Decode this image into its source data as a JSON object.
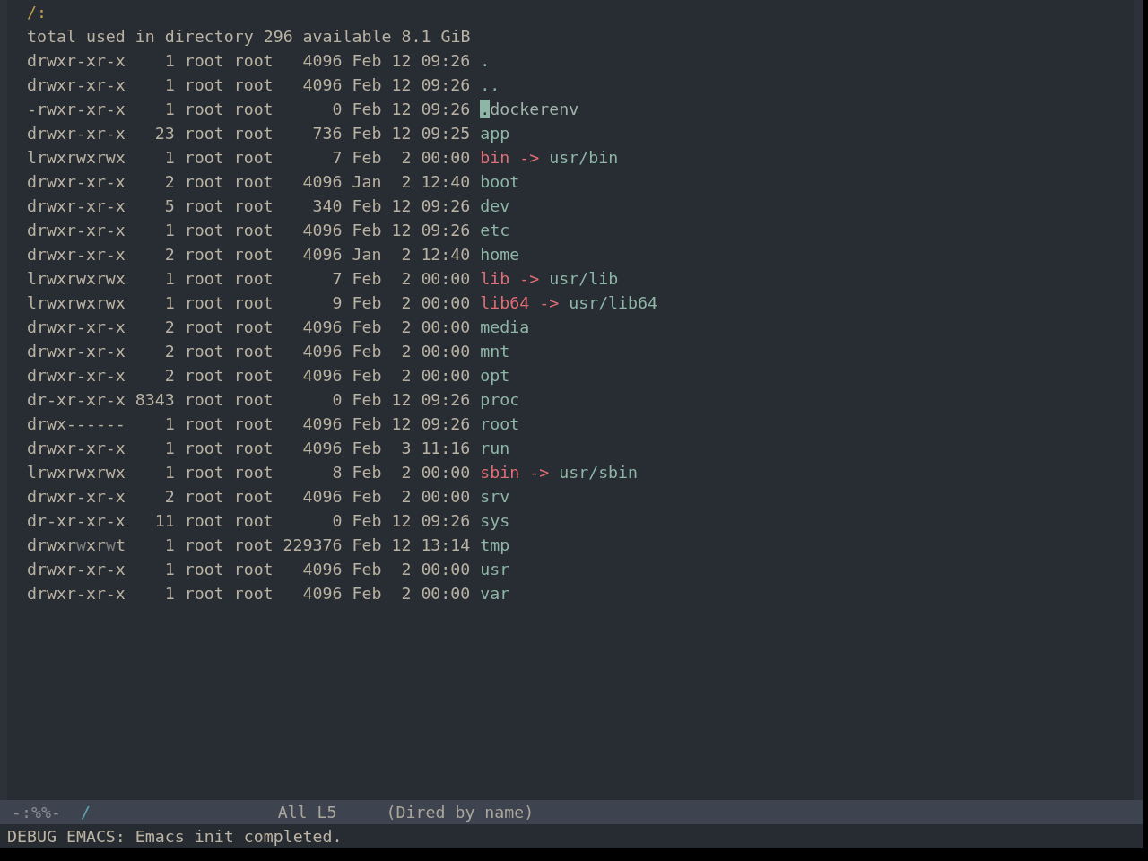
{
  "buffer": {
    "header": "/:",
    "summary": "total used in directory 296 available 8.1 GiB",
    "entries": [
      {
        "permissions": [
          {
            "text": "drwxr-xr-x",
            "dim": false
          }
        ],
        "links": "1",
        "owner": "root",
        "group": "root",
        "size": "4096",
        "month": "Feb",
        "day": "12",
        "time": "09:26",
        "name": ".",
        "kind": "directory",
        "cursor": false
      },
      {
        "permissions": [
          {
            "text": "drwxr-xr-x",
            "dim": false
          }
        ],
        "links": "1",
        "owner": "root",
        "group": "root",
        "size": "4096",
        "month": "Feb",
        "day": "12",
        "time": "09:26",
        "name": "..",
        "kind": "directory",
        "cursor": false
      },
      {
        "permissions": [
          {
            "text": "-rwxr-xr-x",
            "dim": false
          }
        ],
        "links": "1",
        "owner": "root",
        "group": "root",
        "size": "0",
        "month": "Feb",
        "day": "12",
        "time": "09:26",
        "name": ".dockerenv",
        "kind": "file",
        "cursor": true
      },
      {
        "permissions": [
          {
            "text": "drwxr-xr-x",
            "dim": false
          }
        ],
        "links": "23",
        "owner": "root",
        "group": "root",
        "size": "736",
        "month": "Feb",
        "day": "12",
        "time": "09:25",
        "name": "app",
        "kind": "directory",
        "cursor": false
      },
      {
        "permissions": [
          {
            "text": "lrwxrwxrwx",
            "dim": false
          }
        ],
        "links": "1",
        "owner": "root",
        "group": "root",
        "size": "7",
        "month": "Feb",
        "day": "2",
        "time": "00:00",
        "name": "bin",
        "kind": "symlink",
        "arrow": "->",
        "target": "usr/bin",
        "cursor": false
      },
      {
        "permissions": [
          {
            "text": "drwxr-xr-x",
            "dim": false
          }
        ],
        "links": "2",
        "owner": "root",
        "group": "root",
        "size": "4096",
        "month": "Jan",
        "day": "2",
        "time": "12:40",
        "name": "boot",
        "kind": "directory",
        "cursor": false
      },
      {
        "permissions": [
          {
            "text": "drwxr-xr-x",
            "dim": false
          }
        ],
        "links": "5",
        "owner": "root",
        "group": "root",
        "size": "340",
        "month": "Feb",
        "day": "12",
        "time": "09:26",
        "name": "dev",
        "kind": "directory",
        "cursor": false
      },
      {
        "permissions": [
          {
            "text": "drwxr-xr-x",
            "dim": false
          }
        ],
        "links": "1",
        "owner": "root",
        "group": "root",
        "size": "4096",
        "month": "Feb",
        "day": "12",
        "time": "09:26",
        "name": "etc",
        "kind": "directory",
        "cursor": false
      },
      {
        "permissions": [
          {
            "text": "drwxr-xr-x",
            "dim": false
          }
        ],
        "links": "2",
        "owner": "root",
        "group": "root",
        "size": "4096",
        "month": "Jan",
        "day": "2",
        "time": "12:40",
        "name": "home",
        "kind": "directory",
        "cursor": false
      },
      {
        "permissions": [
          {
            "text": "lrwxrwxrwx",
            "dim": false
          }
        ],
        "links": "1",
        "owner": "root",
        "group": "root",
        "size": "7",
        "month": "Feb",
        "day": "2",
        "time": "00:00",
        "name": "lib",
        "kind": "symlink",
        "arrow": "->",
        "target": "usr/lib",
        "cursor": false
      },
      {
        "permissions": [
          {
            "text": "lrwxrwxrwx",
            "dim": false
          }
        ],
        "links": "1",
        "owner": "root",
        "group": "root",
        "size": "9",
        "month": "Feb",
        "day": "2",
        "time": "00:00",
        "name": "lib64",
        "kind": "symlink",
        "arrow": "->",
        "target": "usr/lib64",
        "cursor": false
      },
      {
        "permissions": [
          {
            "text": "drwxr-xr-x",
            "dim": false
          }
        ],
        "links": "2",
        "owner": "root",
        "group": "root",
        "size": "4096",
        "month": "Feb",
        "day": "2",
        "time": "00:00",
        "name": "media",
        "kind": "directory",
        "cursor": false
      },
      {
        "permissions": [
          {
            "text": "drwxr-xr-x",
            "dim": false
          }
        ],
        "links": "2",
        "owner": "root",
        "group": "root",
        "size": "4096",
        "month": "Feb",
        "day": "2",
        "time": "00:00",
        "name": "mnt",
        "kind": "directory",
        "cursor": false
      },
      {
        "permissions": [
          {
            "text": "drwxr-xr-x",
            "dim": false
          }
        ],
        "links": "2",
        "owner": "root",
        "group": "root",
        "size": "4096",
        "month": "Feb",
        "day": "2",
        "time": "00:00",
        "name": "opt",
        "kind": "directory",
        "cursor": false
      },
      {
        "permissions": [
          {
            "text": "dr-xr-xr-x",
            "dim": false
          }
        ],
        "links": "8343",
        "owner": "root",
        "group": "root",
        "size": "0",
        "month": "Feb",
        "day": "12",
        "time": "09:26",
        "name": "proc",
        "kind": "directory",
        "cursor": false
      },
      {
        "permissions": [
          {
            "text": "drwx------",
            "dim": false
          }
        ],
        "links": "1",
        "owner": "root",
        "group": "root",
        "size": "4096",
        "month": "Feb",
        "day": "12",
        "time": "09:26",
        "name": "root",
        "kind": "directory",
        "cursor": false
      },
      {
        "permissions": [
          {
            "text": "drwxr-xr-x",
            "dim": false
          }
        ],
        "links": "1",
        "owner": "root",
        "group": "root",
        "size": "4096",
        "month": "Feb",
        "day": "3",
        "time": "11:16",
        "name": "run",
        "kind": "directory",
        "cursor": false
      },
      {
        "permissions": [
          {
            "text": "lrwxrwxrwx",
            "dim": false
          }
        ],
        "links": "1",
        "owner": "root",
        "group": "root",
        "size": "8",
        "month": "Feb",
        "day": "2",
        "time": "00:00",
        "name": "sbin",
        "kind": "symlink",
        "arrow": "->",
        "target": "usr/sbin",
        "cursor": false
      },
      {
        "permissions": [
          {
            "text": "drwxr-xr-x",
            "dim": false
          }
        ],
        "links": "2",
        "owner": "root",
        "group": "root",
        "size": "4096",
        "month": "Feb",
        "day": "2",
        "time": "00:00",
        "name": "srv",
        "kind": "directory",
        "cursor": false
      },
      {
        "permissions": [
          {
            "text": "dr-xr-xr-x",
            "dim": false
          }
        ],
        "links": "11",
        "owner": "root",
        "group": "root",
        "size": "0",
        "month": "Feb",
        "day": "12",
        "time": "09:26",
        "name": "sys",
        "kind": "directory",
        "cursor": false
      },
      {
        "permissions": [
          {
            "text": "drwxr",
            "dim": false
          },
          {
            "text": "w",
            "dim": true
          },
          {
            "text": "xr",
            "dim": false
          },
          {
            "text": "w",
            "dim": true
          },
          {
            "text": "t",
            "dim": false
          }
        ],
        "links": "1",
        "owner": "root",
        "group": "root",
        "size": "229376",
        "month": "Feb",
        "day": "12",
        "time": "13:14",
        "name": "tmp",
        "kind": "directory",
        "cursor": false
      },
      {
        "permissions": [
          {
            "text": "drwxr-xr-x",
            "dim": false
          }
        ],
        "links": "1",
        "owner": "root",
        "group": "root",
        "size": "4096",
        "month": "Feb",
        "day": "2",
        "time": "00:00",
        "name": "usr",
        "kind": "directory",
        "cursor": false
      },
      {
        "permissions": [
          {
            "text": "drwxr-xr-x",
            "dim": false
          }
        ],
        "links": "1",
        "owner": "root",
        "group": "root",
        "size": "4096",
        "month": "Feb",
        "day": "2",
        "time": "00:00",
        "name": "var",
        "kind": "directory",
        "cursor": false
      }
    ]
  },
  "mode_line": {
    "status": "-:%%-",
    "buffer_name": "/",
    "position": "All",
    "line": "L5",
    "mode": "(Dired by name)"
  },
  "echo_area": {
    "message": "DEBUG EMACS: Emacs init completed."
  }
}
